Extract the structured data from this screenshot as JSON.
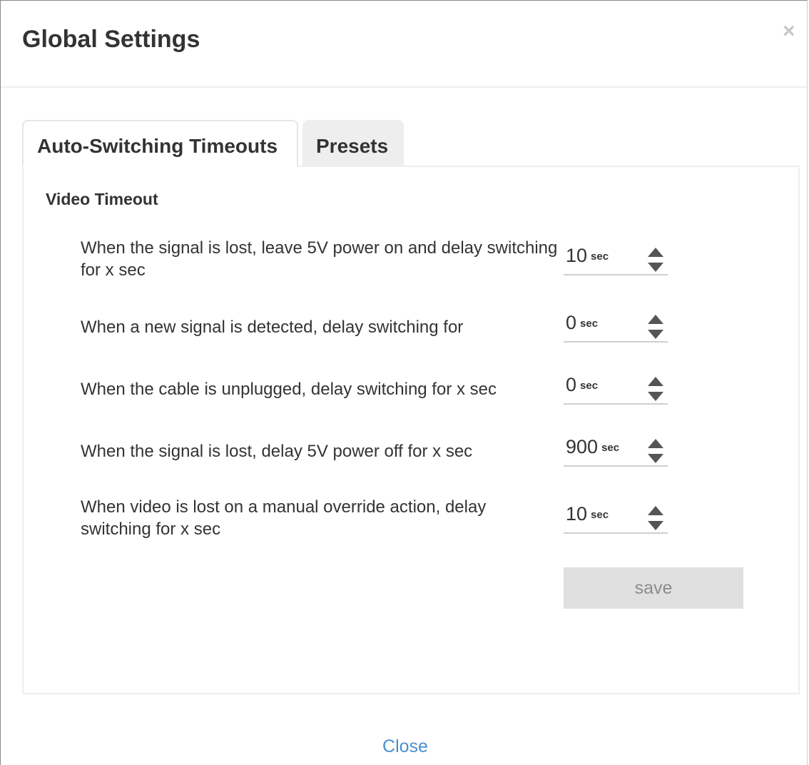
{
  "modal": {
    "title": "Global Settings",
    "close_icon": "close-icon",
    "close_glyph": "×",
    "footer_close_label": "Close"
  },
  "tabs": [
    {
      "label": "Auto-Switching Timeouts",
      "active": true
    },
    {
      "label": "Presets",
      "active": false
    }
  ],
  "video_timeout": {
    "section_title": "Video Timeout",
    "settings": [
      {
        "label": "When the signal is lost, leave 5V power on and delay switching for x sec",
        "value": "10",
        "unit": "sec"
      },
      {
        "label": "When a new signal is detected, delay switching for",
        "value": "0",
        "unit": "sec"
      },
      {
        "label": "When the cable is unplugged, delay switching for x sec",
        "value": "0",
        "unit": "sec"
      },
      {
        "label": "When the signal is lost, delay 5V power off for x sec",
        "value": "900",
        "unit": "sec"
      },
      {
        "label": "When video is lost on a manual override action, delay switching for x sec",
        "value": "10",
        "unit": "sec"
      }
    ],
    "save_label": "save"
  },
  "colors": {
    "link": "#4a8fcf",
    "text": "#333333",
    "button_disabled_bg": "#e0e0e0",
    "button_disabled_text": "#8c8c8c"
  }
}
